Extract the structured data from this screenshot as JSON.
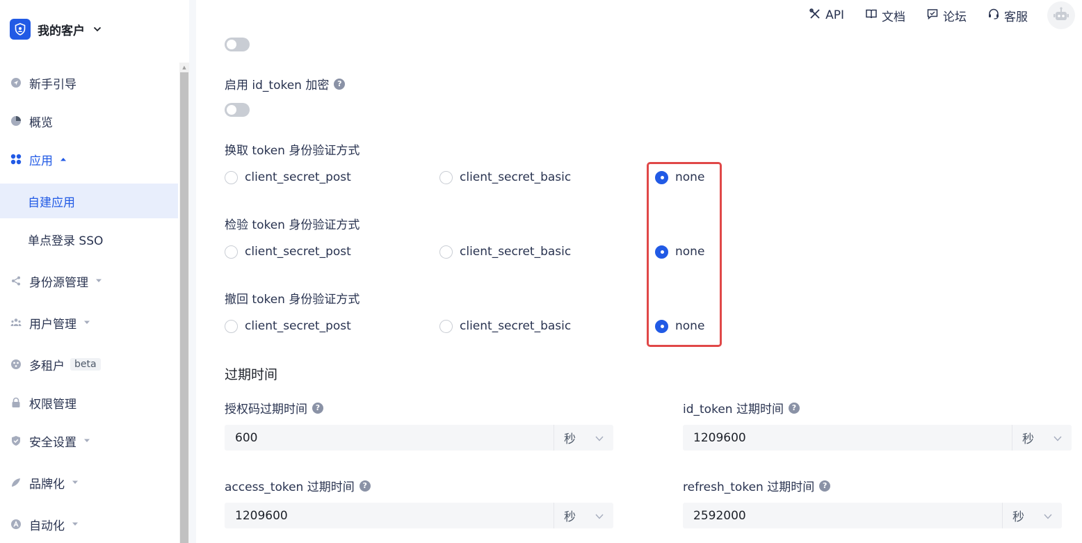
{
  "brand": {
    "name": "我的客户"
  },
  "sidebar": {
    "items": [
      {
        "label": "新手引导"
      },
      {
        "label": "概览"
      },
      {
        "label": "应用"
      },
      {
        "label": "自建应用"
      },
      {
        "label": "单点登录 SSO"
      },
      {
        "label": "身份源管理"
      },
      {
        "label": "用户管理"
      },
      {
        "label": "多租户",
        "badge": "beta"
      },
      {
        "label": "权限管理"
      },
      {
        "label": "安全设置"
      },
      {
        "label": "品牌化"
      },
      {
        "label": "自动化"
      }
    ]
  },
  "topbar": {
    "api": "API",
    "docs": "文档",
    "forum": "论坛",
    "support": "客服"
  },
  "form": {
    "id_token_encrypt": {
      "label": "启用 id_token 加密"
    },
    "token_exchange": {
      "label": "换取 token 身份验证方式",
      "options": [
        "client_secret_post",
        "client_secret_basic",
        "none"
      ],
      "selected": "none"
    },
    "token_introspect": {
      "label": "检验 token 身份验证方式",
      "options": [
        "client_secret_post",
        "client_secret_basic",
        "none"
      ],
      "selected": "none"
    },
    "token_revoke": {
      "label": "撤回 token 身份验证方式",
      "options": [
        "client_secret_post",
        "client_secret_basic",
        "none"
      ],
      "selected": "none"
    },
    "expiry": {
      "title": "过期时间",
      "auth_code": {
        "label": "授权码过期时间",
        "value": "600",
        "unit": "秒"
      },
      "id_token": {
        "label": "id_token 过期时间",
        "value": "1209600",
        "unit": "秒"
      },
      "access_token": {
        "label": "access_token 过期时间",
        "value": "1209600",
        "unit": "秒"
      },
      "refresh_token": {
        "label": "refresh_token 过期时间",
        "value": "2592000",
        "unit": "秒"
      }
    }
  },
  "colors": {
    "accent": "#215ae5",
    "highlight": "#e04848"
  }
}
